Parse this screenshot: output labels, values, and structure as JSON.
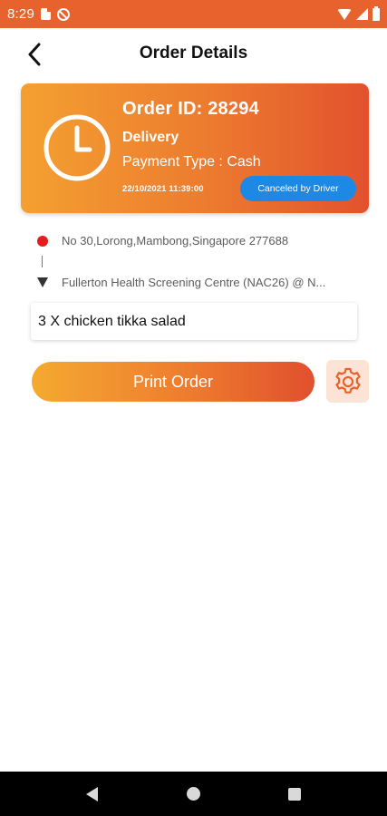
{
  "status_bar": {
    "time": "8:29",
    "icons": [
      "sim-card-icon",
      "block-icon",
      "wifi-icon",
      "signal-icon",
      "battery-icon"
    ]
  },
  "header": {
    "title": "Order Details",
    "back_icon": "chevron-left-icon"
  },
  "order": {
    "id_label": "Order ID: 28294",
    "type": "Delivery",
    "payment": "Payment Type : Cash",
    "datetime": "22/10/2021 11:39:00",
    "status": "Canceled by Driver",
    "icon": "clock-icon"
  },
  "addresses": {
    "pickup": "No 30,Lorong,Mambong,Singapore 277688",
    "dropoff": "Fullerton Health Screening Centre (NAC26) @ N..."
  },
  "items": [
    "3 X chicken tikka salad"
  ],
  "actions": {
    "print_label": "Print Order",
    "settings_icon": "gear-icon"
  },
  "colors": {
    "status_bar": "#e8622e",
    "gradient_start": "#f4a030",
    "gradient_end": "#e2522d",
    "badge": "#1e88e5",
    "pickup_dot": "#e51c1c",
    "settings_bg": "#fde3d6"
  },
  "nav_bar": {
    "icons": [
      "nav-back-icon",
      "nav-home-icon",
      "nav-recents-icon"
    ]
  }
}
